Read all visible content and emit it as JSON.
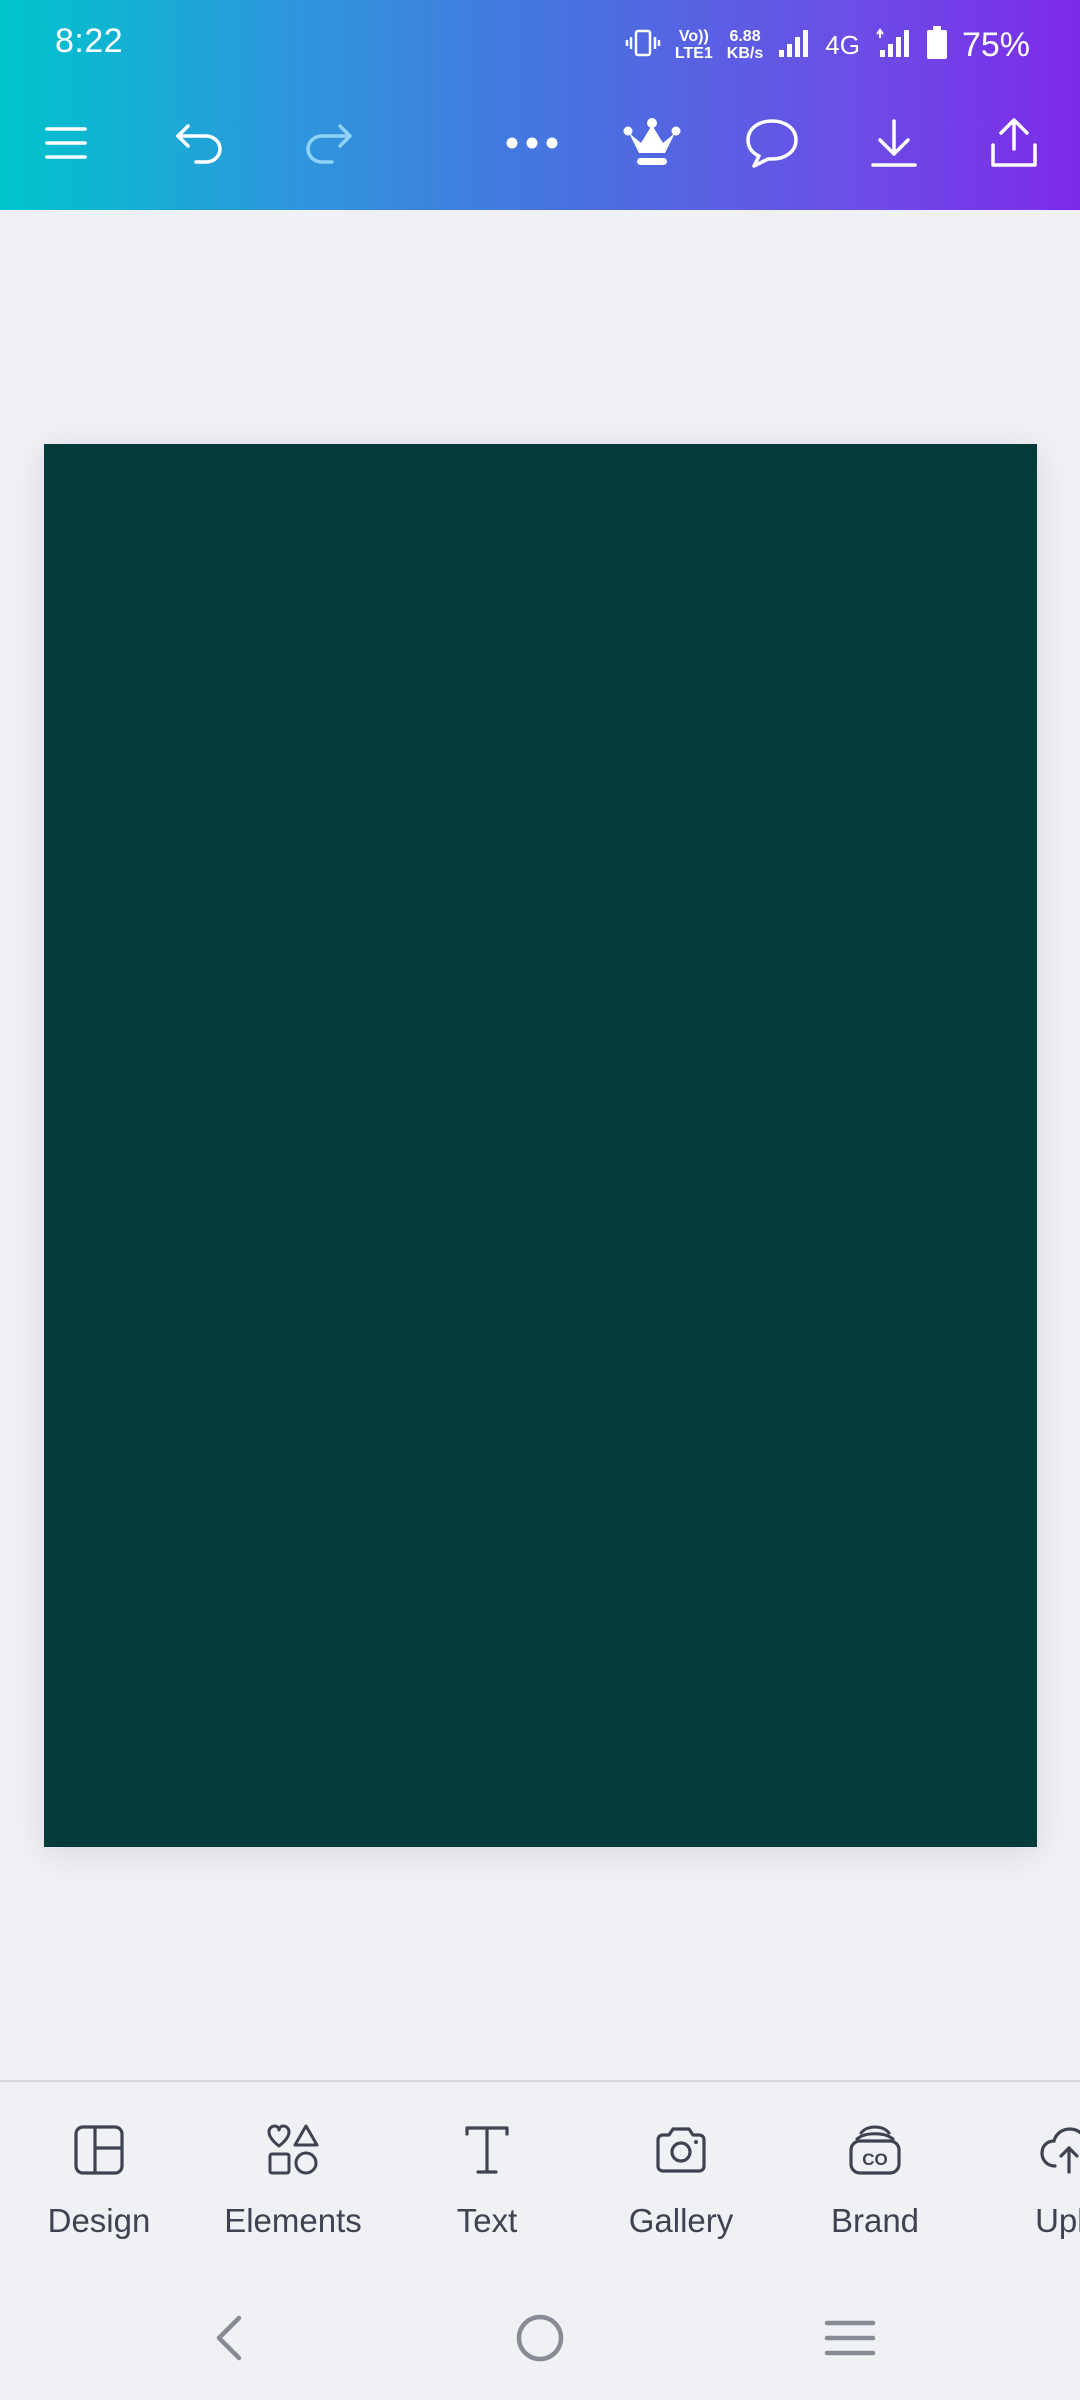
{
  "status_bar": {
    "time": "8:22",
    "volte_line1": "Vo))",
    "volte_line2": "LTE1",
    "speed_value": "6.88",
    "speed_unit": "KB/s",
    "network_type": "4G",
    "battery_percent": "75%"
  },
  "toolbar": {
    "icons": [
      "menu-icon",
      "undo-icon",
      "redo-icon",
      "more-icon",
      "crown-icon",
      "comment-icon",
      "download-icon",
      "share-icon"
    ]
  },
  "canvas": {
    "page_color": "#033a3a"
  },
  "bottom_tools": {
    "items": [
      {
        "label": "Design",
        "icon": "layout-icon"
      },
      {
        "label": "Elements",
        "icon": "shapes-icon"
      },
      {
        "label": "Text",
        "icon": "text-icon"
      },
      {
        "label": "Gallery",
        "icon": "camera-icon"
      },
      {
        "label": "Brand",
        "icon": "brand-icon"
      },
      {
        "label": "Uplo",
        "icon": "upload-cloud-icon"
      }
    ]
  },
  "system_nav": {
    "icons": [
      "back-icon",
      "home-icon",
      "recents-icon"
    ]
  },
  "colors": {
    "header_gradient_start": "#00c4cc",
    "header_gradient_end": "#7d2ae8",
    "background": "#f0f1f5",
    "label_text": "#3d4350"
  }
}
